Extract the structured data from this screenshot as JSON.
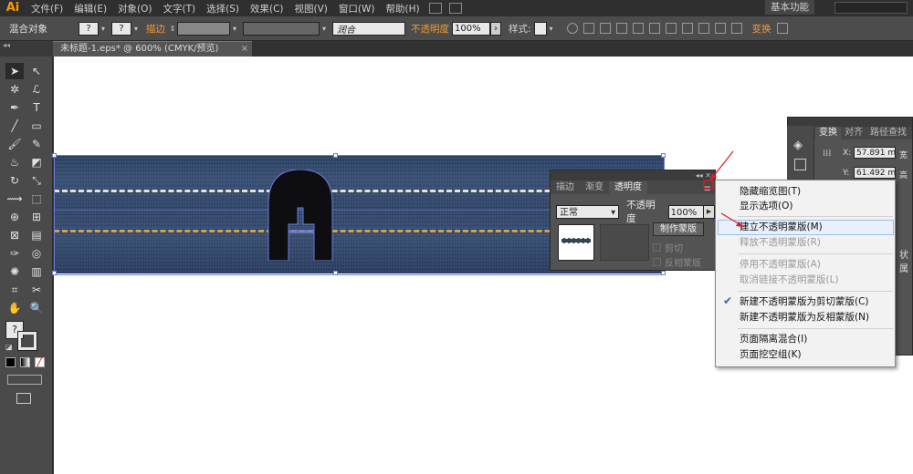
{
  "app": {
    "logo": "Ai"
  },
  "menubar": {
    "items": [
      "文件(F)",
      "编辑(E)",
      "对象(O)",
      "文字(T)",
      "选择(S)",
      "效果(C)",
      "视图(V)",
      "窗口(W)",
      "帮助(H)"
    ],
    "workspace": "基本功能"
  },
  "control": {
    "selection_label": "混合对象",
    "stroke_label": "描边",
    "brush_value": "润合",
    "opacity_label": "不透明度",
    "opacity_value": "100%",
    "style_label": "样式:",
    "transform_label": "变换"
  },
  "document": {
    "tab_title": "未标题-1.eps* @ 600% (CMYK/预览)",
    "close_glyph": "×"
  },
  "transparency_panel": {
    "tabs": [
      "描边",
      "渐变",
      "透明度"
    ],
    "blend_mode": "正常",
    "opacity_label": "不透明度",
    "opacity_value": "100%",
    "make_mask_button": "制作蒙版",
    "clip_label": "剪切",
    "invert_label": "反相蒙版"
  },
  "flyout_menu": {
    "items": [
      {
        "label": "隐藏缩览图(T)",
        "enabled": true
      },
      {
        "label": "显示选项(O)",
        "enabled": true
      },
      {
        "label": "建立不透明蒙版(M)",
        "enabled": true,
        "highlighted": true
      },
      {
        "label": "释放不透明蒙版(R)",
        "enabled": false
      },
      {
        "label": "停用不透明蒙版(A)",
        "enabled": false
      },
      {
        "label": "取消链接不透明蒙版(L)",
        "enabled": false
      },
      {
        "label": "新建不透明蒙版为剪切蒙版(C)",
        "enabled": true,
        "checked": true
      },
      {
        "label": "新建不透明蒙版为反相蒙版(N)",
        "enabled": true
      },
      {
        "label": "页面隔离混合(I)",
        "enabled": true
      },
      {
        "label": "页面挖空组(K)",
        "enabled": true
      }
    ]
  },
  "transform_panel": {
    "tabs": [
      "变换",
      "对齐",
      "路径查找"
    ],
    "x_label": "X:",
    "x_value": "57.891 m",
    "y_label": "Y:",
    "y_value": "61.492 m",
    "w_label": "宽",
    "h_label": "高",
    "partial_label": "状属"
  },
  "colors": {
    "accent_orange": "#f09a30",
    "selection_blue": "#6f7bd6",
    "arrow_red": "#d42020",
    "denim_blue": "#34496c",
    "stitch_white": "#e6e2d4",
    "stitch_gold": "#d2a046"
  }
}
